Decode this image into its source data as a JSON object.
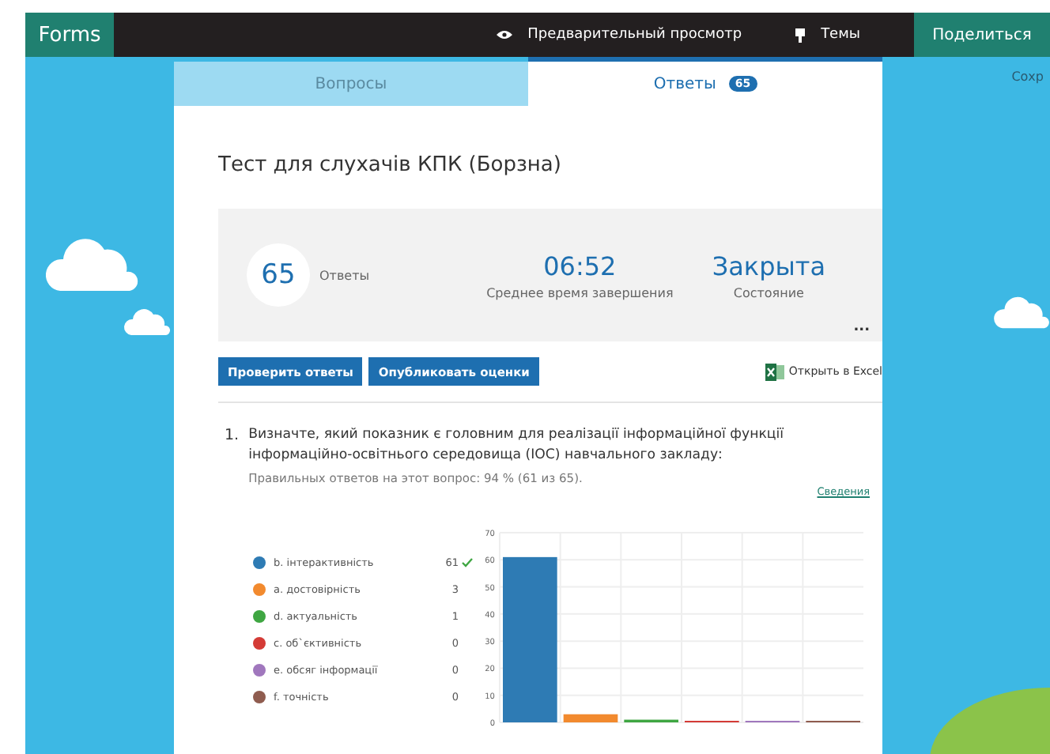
{
  "header": {
    "app_name": "Forms",
    "preview": "Предварительный просмотр",
    "themes": "Темы",
    "share": "Поделиться"
  },
  "side_text": "Сохр",
  "tabs": [
    {
      "label": "Вопросы",
      "selected": false
    },
    {
      "label": "Ответы",
      "badge": "65",
      "selected": true
    }
  ],
  "form_title": "Тест для слухачів КПК (Борзна)",
  "summary": {
    "responses_count": "65",
    "responses_label": "Ответы",
    "avg_time": "06:52",
    "avg_time_label": "Среднее время завершения",
    "status": "Закрыта",
    "status_label": "Состояние",
    "more": "..."
  },
  "actions": {
    "review": "Проверить ответы",
    "publish": "Опубликовать оценки",
    "excel": "Открыть в Excel"
  },
  "question": {
    "number": "1.",
    "text": "Визначте, який показник є головним для реалізації інформаційної функції інформаційно-освітнього середовища (ІОС) навчального закладу:",
    "stats": "Правильных ответов на этот вопрос: 94 % (61 из 65).",
    "details": "Сведения",
    "options": [
      {
        "label": "b. інтерактивність",
        "count": "61",
        "correct": true,
        "color": "#2e7bb4"
      },
      {
        "label": "a. достовірність",
        "count": "3",
        "correct": false,
        "color": "#f28a2e"
      },
      {
        "label": "d. актуальність",
        "count": "1",
        "correct": false,
        "color": "#3fa642"
      },
      {
        "label": "c. об`єктивність",
        "count": "0",
        "correct": false,
        "color": "#d43b36"
      },
      {
        "label": "e. обсяг інформації",
        "count": "0",
        "correct": false,
        "color": "#a077bd"
      },
      {
        "label": "f. точність",
        "count": "0",
        "correct": false,
        "color": "#8f5c4f"
      }
    ],
    "chart_data": {
      "type": "bar",
      "values": [
        61,
        3,
        1,
        0,
        0,
        0
      ],
      "ylim": [
        0,
        70
      ],
      "yticks": [
        0,
        10,
        20,
        30,
        40,
        50,
        60,
        70
      ],
      "grid": true
    }
  }
}
